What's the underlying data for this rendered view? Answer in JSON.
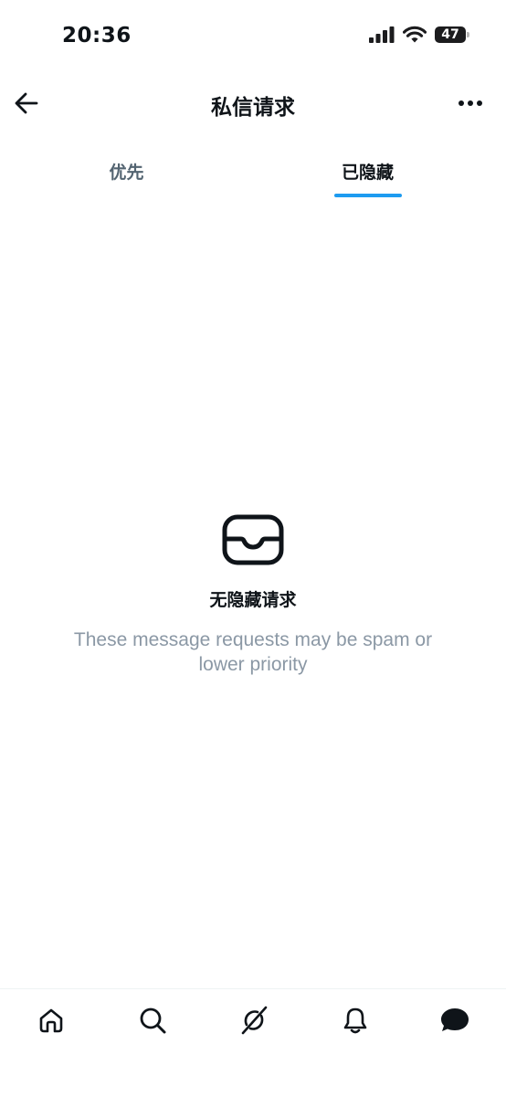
{
  "status_bar": {
    "time": "20:36",
    "battery": "47",
    "icons": [
      "signal-icon",
      "wifi-icon",
      "battery-icon"
    ]
  },
  "header": {
    "title": "私信请求",
    "back_icon": "arrow-left-icon",
    "more_icon": "more-horizontal-icon"
  },
  "tabs": [
    {
      "label": "优先",
      "active": false
    },
    {
      "label": "已隐藏",
      "active": true
    }
  ],
  "empty_state": {
    "icon": "inbox-icon",
    "title": "无隐藏请求",
    "subtitle": "These message requests may be spam or lower priority"
  },
  "bottom_nav": {
    "items": [
      "home-icon",
      "search-icon",
      "grok-icon",
      "notifications-icon",
      "messages-icon"
    ],
    "active": "messages-icon"
  },
  "colors": {
    "accent": "#1d9bf0",
    "text": "#0f1419",
    "secondary_text": "#536471",
    "subtitle_text": "#8b98a5"
  }
}
